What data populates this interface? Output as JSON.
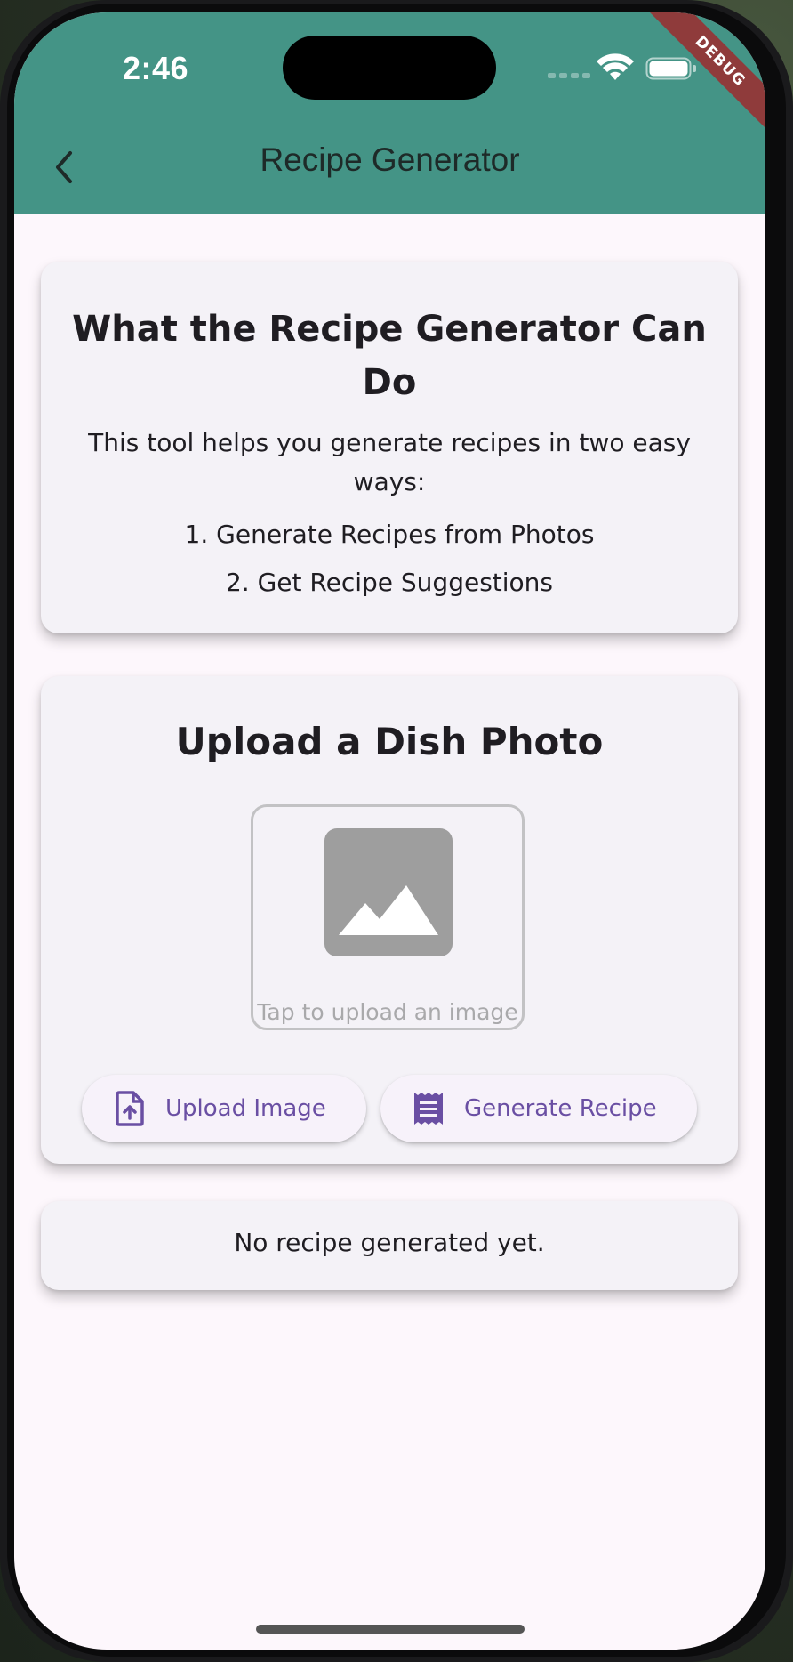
{
  "status_bar": {
    "time": "2:46",
    "debug_label": "DEBUG"
  },
  "app_bar": {
    "title": "Recipe Generator",
    "back_icon": "chevron-left-icon",
    "color": "#449486"
  },
  "info_card": {
    "title": "What the Recipe Generator Can Do",
    "description": "This tool helps you generate recipes in two easy ways:",
    "items": [
      "1. Generate Recipes from Photos",
      "2. Get Recipe Suggestions"
    ]
  },
  "upload_card": {
    "title": "Upload a Dish Photo",
    "placeholder_icon": "image-icon",
    "upload_hint": "Tap to upload an image",
    "buttons": {
      "upload_label": "Upload Image",
      "upload_icon": "upload-file-icon",
      "generate_label": "Generate Recipe",
      "generate_icon": "receipt-icon"
    },
    "accent_color": "#6a4fa3"
  },
  "result_card": {
    "text": "No recipe generated yet."
  }
}
